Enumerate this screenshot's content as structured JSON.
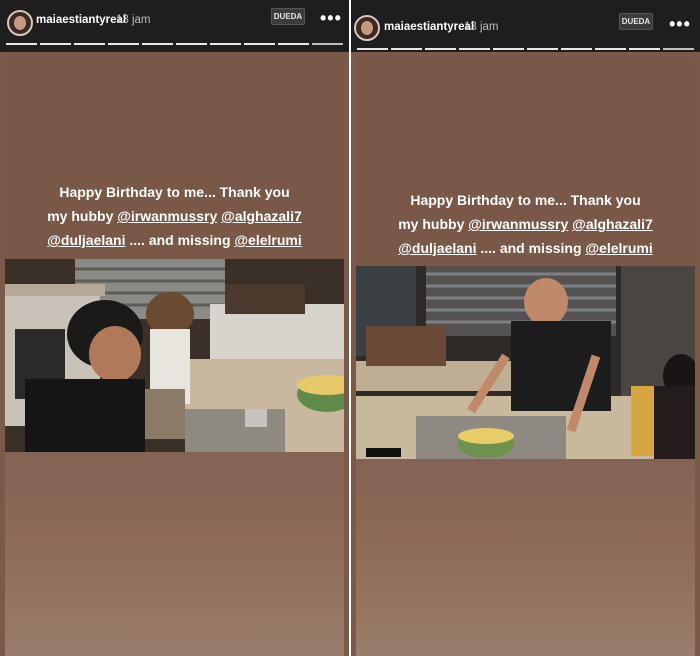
{
  "stories": [
    {
      "username": "maiaestiantyreal",
      "time_ago": "13 jam",
      "lang_button": "DUEDA",
      "more_label": "•••",
      "progress": {
        "segments": 10,
        "current": 10
      },
      "caption": {
        "line1": "Happy Birthday to me... Thank you",
        "line2_prefix": "my hubby ",
        "mention1": "@irwanmussry",
        "mention2": "@alghazali7",
        "mention3": "@duljaelani",
        "line3_middle": " .... and missing ",
        "mention4": "@elelrumi"
      },
      "photo_alt": "young man blowing birthday cake candle at dining table"
    },
    {
      "username": "maiaestiantyreal",
      "time_ago": "13 jam",
      "lang_button": "DUEDA",
      "more_label": "•••",
      "progress": {
        "segments": 10,
        "current": 10
      },
      "caption": {
        "line1": "Happy Birthday to me... Thank you",
        "line2_prefix": "my hubby ",
        "mention1": "@irwanmussry",
        "mention2": "@alghazali7",
        "mention3": "@duljaelani",
        "line3_middle": " .... and missing ",
        "mention4": "@elelrumi"
      },
      "photo_alt": "man lighting candle on birthday cake"
    }
  ],
  "colors": {
    "topbar": "#1e1e1e",
    "story_bg": "#7a5848",
    "caption_text": "#ffffff"
  }
}
